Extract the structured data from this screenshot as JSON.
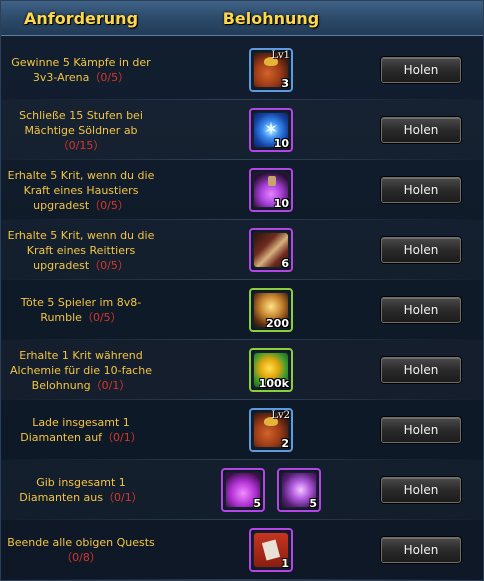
{
  "header": {
    "requirement": "Anforderung",
    "reward": "Belohnung"
  },
  "button_label": "Holen",
  "rows": [
    {
      "text": "Gewinne 5 Kämpfe in der 3v3-Arena",
      "progress": "（0/5）",
      "items": [
        {
          "icon": "treasure-bag-icon",
          "qty": "3",
          "lvl": "Lv1"
        }
      ]
    },
    {
      "text": "Schließe 15 Stufen bei Mächtige Söldner ab",
      "progress": "（0/15）",
      "items": [
        {
          "icon": "blue-rune-icon",
          "qty": "10"
        }
      ]
    },
    {
      "text": "Erhalte 5 Krit, wenn du die Kraft eines Haustiers upgradest",
      "progress": "（0/5）",
      "items": [
        {
          "icon": "purple-potion-icon",
          "qty": "10"
        }
      ]
    },
    {
      "text": "Erhalte 5 Krit, wenn du die Kraft eines Reittiers upgradest",
      "progress": "（0/5）",
      "items": [
        {
          "icon": "scroll-icon",
          "qty": "6"
        }
      ]
    },
    {
      "text": "Töte 5 Spieler im 8v8-Rumble",
      "progress": "（0/5）",
      "items": [
        {
          "icon": "golden-beast-icon",
          "qty": "200"
        }
      ]
    },
    {
      "text": "Erhalte 1 Krit während Alchemie für die 10-fache Belohnung",
      "progress": "（0/1）",
      "items": [
        {
          "icon": "gold-coins-icon",
          "qty": "100k"
        }
      ]
    },
    {
      "text": "Lade insgesamt 1 Diamanten auf",
      "progress": "（0/1）",
      "items": [
        {
          "icon": "treasure-bag-icon",
          "qty": "2",
          "lvl": "Lv2"
        }
      ]
    },
    {
      "text": "Gib insgesamt 1 Diamanten aus",
      "progress": "（0/1）",
      "items": [
        {
          "icon": "heart-potion-icon",
          "qty": "5"
        },
        {
          "icon": "purple-crystal-icon",
          "qty": "5"
        }
      ]
    },
    {
      "text": "Beende alle obigen Quests",
      "progress": "（0/8）",
      "items": [
        {
          "icon": "red-card-icon",
          "qty": "1"
        }
      ]
    }
  ]
}
